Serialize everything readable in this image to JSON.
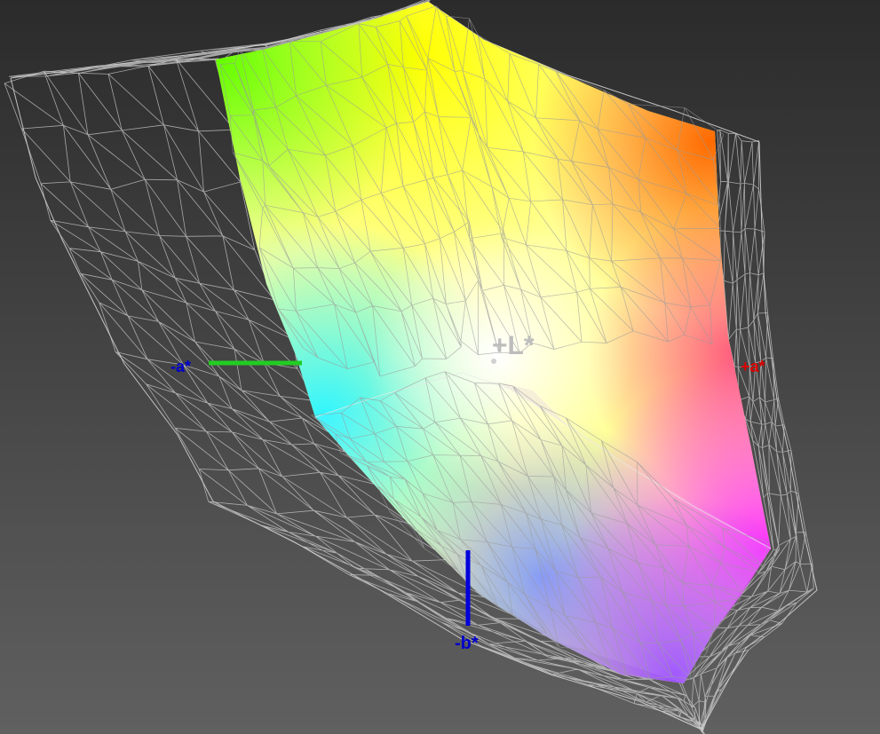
{
  "labels": {
    "plus_l": "+L*",
    "minus_a": "-a*",
    "plus_a": "+a*",
    "minus_b": "-b*"
  },
  "colors": {
    "background_top": "#2b2b2b",
    "background_bottom": "#606060",
    "mesh": "#d8d8d8",
    "axis_green": "#22cc22",
    "axis_blue": "#0000dd",
    "label_blue": "#0000cc",
    "label_red": "#dd0000",
    "label_grey": "#bdbdbd"
  }
}
